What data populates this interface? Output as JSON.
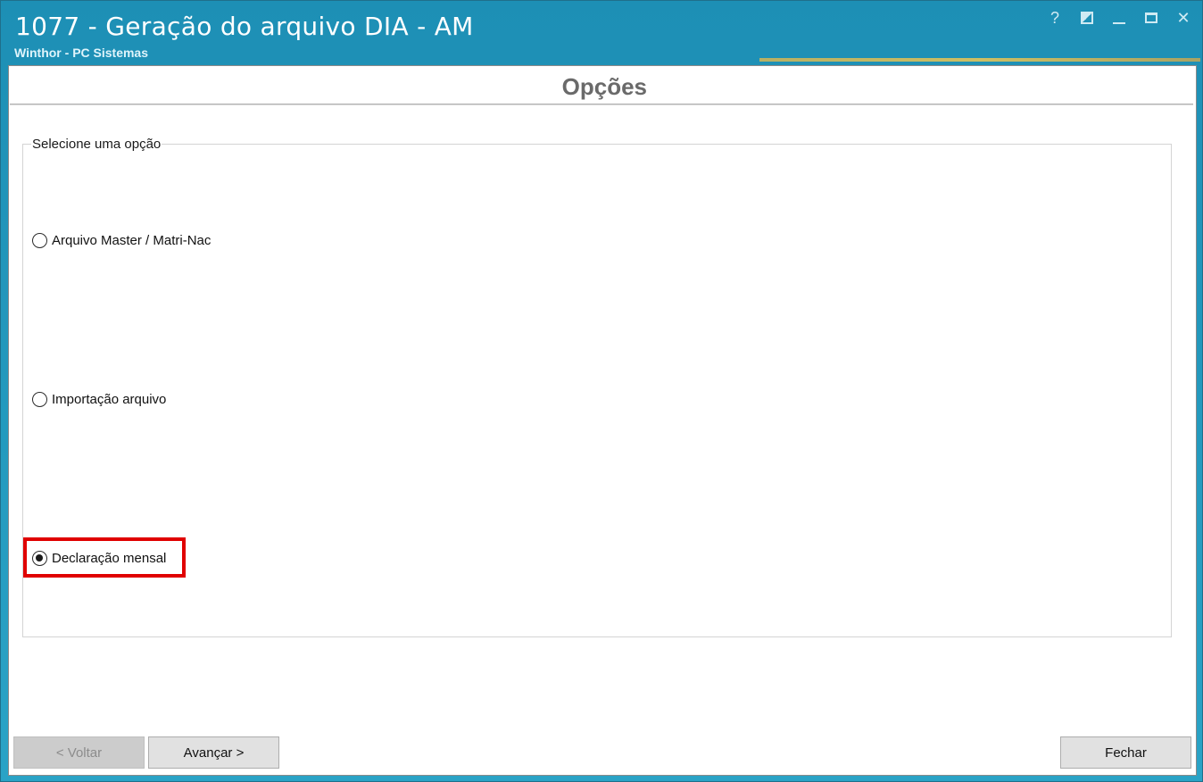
{
  "window": {
    "title": "1077 - Geração do arquivo DIA - AM",
    "subtitle": "Winthor - PC Sistemas",
    "controls": {
      "help": "?",
      "close": "✕"
    }
  },
  "header": {
    "title": "Opções"
  },
  "group": {
    "legend": "Selecione uma opção",
    "options": [
      {
        "label": "Arquivo Master / Matri-Nac",
        "checked": false
      },
      {
        "label": "Importação arquivo",
        "checked": false
      },
      {
        "label": "Declaração mensal",
        "checked": true
      }
    ]
  },
  "buttons": {
    "back": "< Voltar",
    "next": "Avançar >",
    "close": "Fechar"
  },
  "colors": {
    "titlebar": "#1d8fb5",
    "highlight": "#e00000"
  },
  "icons": {
    "help": "help-icon",
    "restore": "restore-icon",
    "minimize": "minimize-icon",
    "maximize": "maximize-icon",
    "close": "close-icon"
  }
}
